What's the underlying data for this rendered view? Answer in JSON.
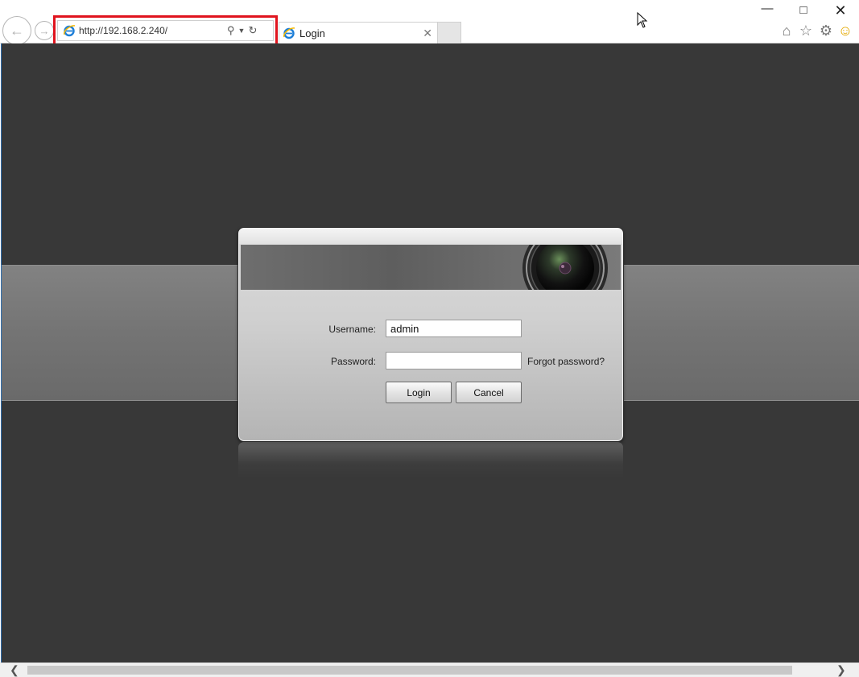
{
  "browser": {
    "url": "http://192.168.2.240/",
    "tab_title": "Login",
    "back_glyph": "←",
    "forward_glyph": "→",
    "close_tab_glyph": "✕",
    "min_glyph": "—",
    "max_glyph": "□",
    "close_glyph": "✕",
    "highlight_color": "#e0141e",
    "icons": [
      "ie-logo-icon",
      "search-icon",
      "dropdown-icon",
      "refresh-icon",
      "home-icon",
      "favorites-star-icon",
      "gear-icon",
      "smiley-feedback-icon"
    ]
  },
  "login": {
    "username_label": "Username:",
    "username_value": "admin",
    "password_label": "Password:",
    "password_value": "",
    "forgot_link": "Forgot password?",
    "login_button": "Login",
    "cancel_button": "Cancel",
    "banner_icon": "camera-lens-icon"
  },
  "colors": {
    "page_background": "#383838",
    "band": "#787878",
    "dialog": "#cfcfcf"
  }
}
